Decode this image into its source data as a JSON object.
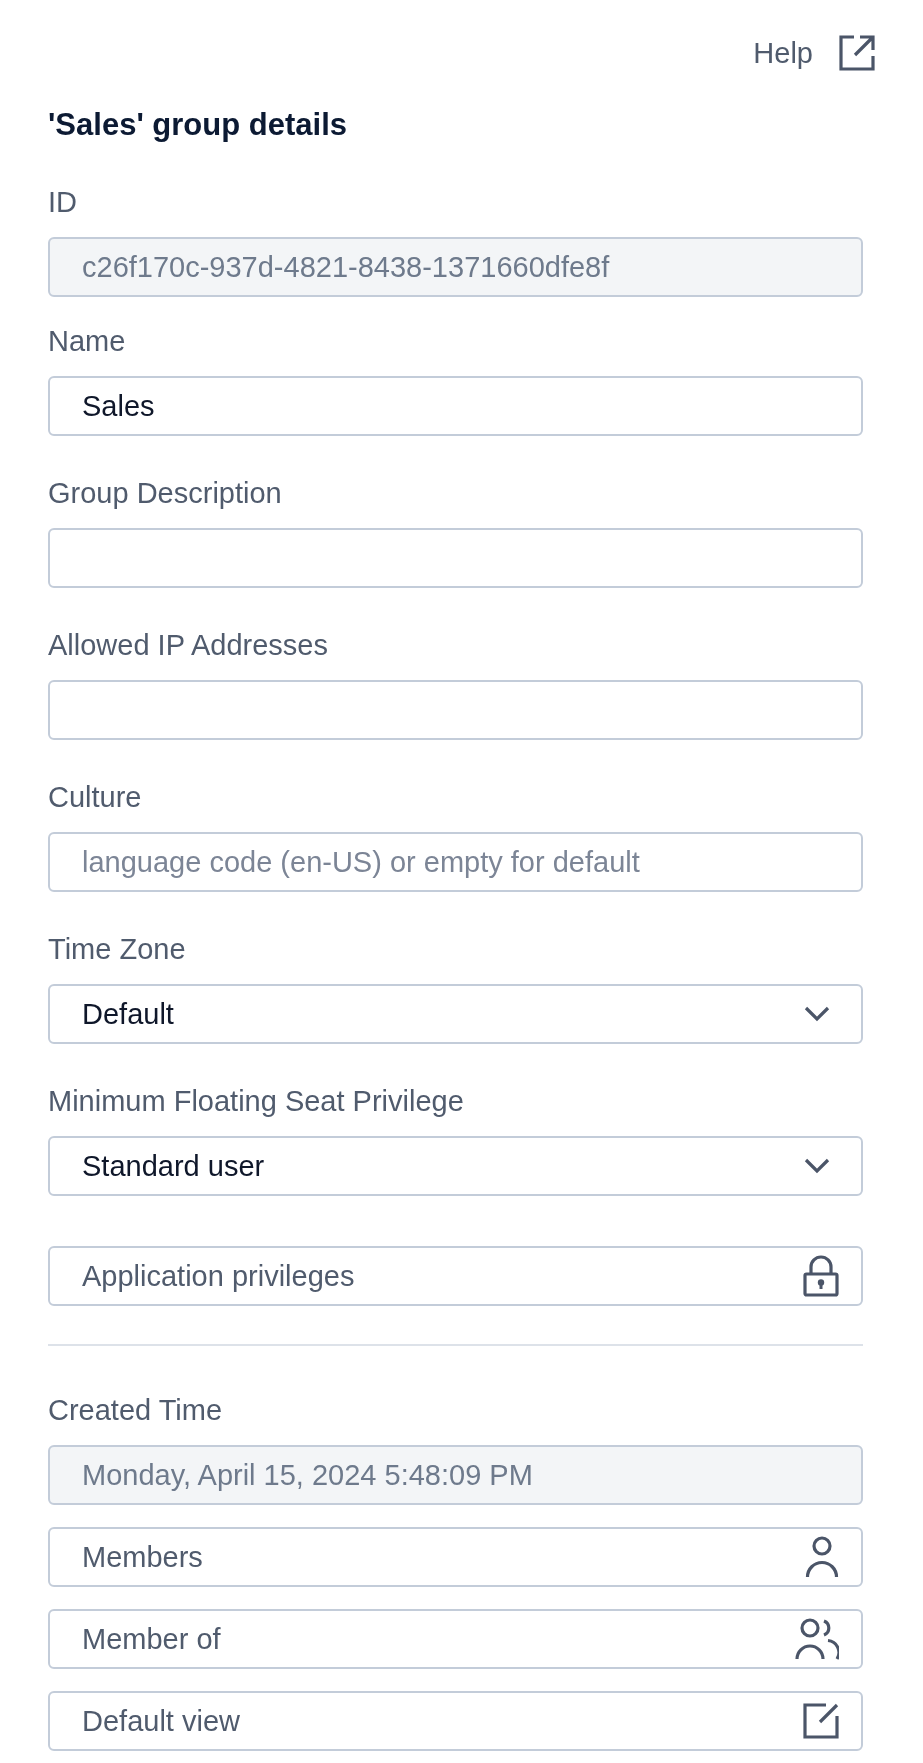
{
  "header": {
    "help_link": "Help"
  },
  "title": "'Sales' group details",
  "fields": [
    {
      "kind": "text",
      "label": "ID",
      "value": "c26f170c-937d-4821-8438-1371660dfe8f",
      "disabled": true
    },
    {
      "kind": "text",
      "label": "Name",
      "value": "Sales",
      "disabled": false
    },
    {
      "kind": "text",
      "label": "Group Description",
      "disabled": false
    },
    {
      "kind": "text",
      "label": "Allowed IP Addresses",
      "disabled": false
    },
    {
      "kind": "text",
      "label": "Culture",
      "placeholder": "language code (en-US) or empty for default",
      "disabled": false
    },
    {
      "kind": "select",
      "label": "Time Zone",
      "value": "Default",
      "disabled": false
    },
    {
      "kind": "select",
      "label": "Minimum Floating Seat Privilege",
      "value": "Standard user",
      "disabled": false
    },
    {
      "kind": "privileges",
      "text": "Application privileges",
      "disabled": false
    }
  ],
  "details": [
    {
      "kind": "text",
      "label": "Created Time",
      "value": "Monday, April 15, 2024 5:48:09 PM",
      "disabled": true
    },
    {
      "kind": "members",
      "text": "Members",
      "disabled": false
    },
    {
      "kind": "groups",
      "text": "Member of",
      "disabled": false
    },
    {
      "kind": "view",
      "text": "Default view",
      "disabled": false
    }
  ]
}
